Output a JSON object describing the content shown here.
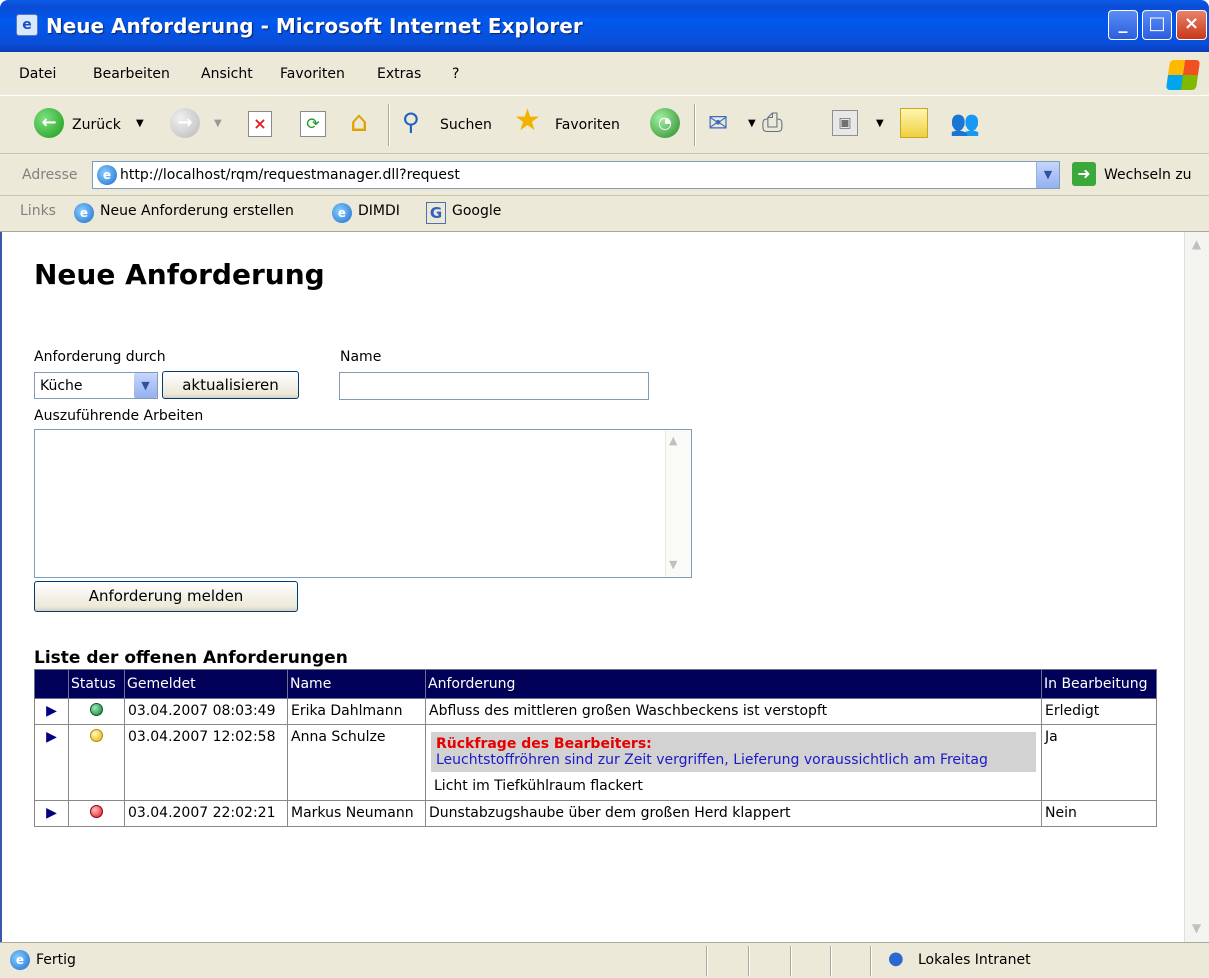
{
  "window": {
    "title": "Neue Anforderung - Microsoft Internet Explorer"
  },
  "menu": [
    "Datei",
    "Bearbeiten",
    "Ansicht",
    "Favoriten",
    "Extras",
    "?"
  ],
  "toolbar": {
    "back_label": "Zurück",
    "search_label": "Suchen",
    "favorites_label": "Favoriten"
  },
  "address": {
    "label": "Adresse",
    "url": "http://localhost/rqm/requestmanager.dll?request",
    "go_label": "Wechseln zu"
  },
  "links": {
    "label": "Links",
    "items": [
      "Neue Anforderung erstellen",
      "DIMDI",
      "Google"
    ]
  },
  "page": {
    "title": "Neue Anforderung",
    "requester_label": "Anforderung durch",
    "requester_value": "Küche",
    "refresh_button": "aktualisieren",
    "name_label": "Name",
    "name_value": "",
    "work_label": "Auszuführende Arbeiten",
    "work_value": "",
    "submit_button": "Anforderung melden",
    "list_heading": "Liste der offenen Anforderungen"
  },
  "table": {
    "columns": [
      "",
      "Status",
      "Gemeldet",
      "Name",
      "Anforderung",
      "In Bearbeitung"
    ],
    "rows": [
      {
        "status": "green",
        "reported": "03.04.2007 08:03:49",
        "name": "Erika Dahlmann",
        "request": "Abfluss des mittleren großen Waschbeckens ist verstopft",
        "in_progress": "Erledigt"
      },
      {
        "status": "yellow",
        "reported": "03.04.2007 12:02:58",
        "name": "Anna Schulze",
        "inquiry_title": "Rückfrage des Bearbeiters:",
        "inquiry_text": "Leuchtstoffröhren sind zur Zeit vergriffen, Lieferung voraussichtlich am Freitag",
        "request": "Licht im Tiefkühlraum flackert",
        "in_progress": "Ja"
      },
      {
        "status": "red",
        "reported": "03.04.2007 22:02:21",
        "name": "Markus Neumann",
        "request": "Dunstabzugshaube über dem großen Herd klappert",
        "in_progress": "Nein"
      }
    ]
  },
  "status": {
    "left": "Fertig",
    "zone": "Lokales Intranet"
  },
  "colors": {
    "titlebar": "#0058ee",
    "table_header": "#000058",
    "inquiry_title": "#e80000",
    "inquiry_text": "#1a1ac8"
  }
}
